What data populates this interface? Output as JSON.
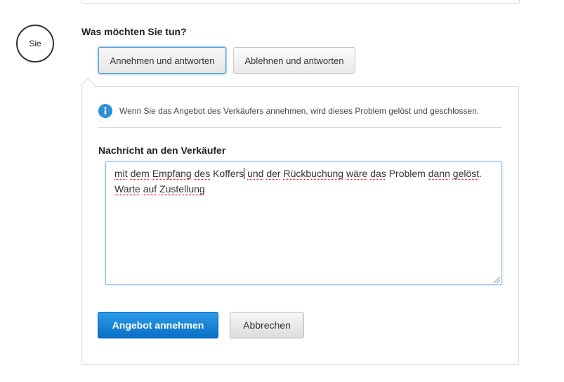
{
  "avatar": {
    "label": "Sie"
  },
  "question": "Was möchten Sie tun?",
  "options": {
    "accept_label": "Annehmen und antworten",
    "reject_label": "Ablehnen und antworten",
    "selected": "Annehmen und antworten"
  },
  "info": {
    "icon": "info-icon",
    "text": "Wenn Sie das Angebot des Verkäufers annehmen, wird dieses Problem gelöst und geschlossen."
  },
  "message": {
    "label": "Nachricht an den Verkäufer",
    "line1": {
      "w1": "mit",
      "s1": " ",
      "w2": "dem",
      "s2": " ",
      "w3": "Empfang",
      "s3": " ",
      "w4": "des",
      "s4": " ",
      "w5": "Koffers",
      "s5": " ",
      "w6": "und",
      "s6": " ",
      "w7": "der",
      "s7": " ",
      "w8": "Rückbuchung",
      "s8": " ",
      "w9": "wäre",
      "s9": " ",
      "w10": "das",
      "s10": " Problem ",
      "w11": "dann",
      "s11": " ",
      "w12": "gelöst",
      "s12": "."
    },
    "line2": {
      "w1": "Warte",
      "s1": " ",
      "w2": "auf",
      "s2": " ",
      "w3": "Zustellung"
    }
  },
  "actions": {
    "primary_label": "Angebot annehmen",
    "secondary_label": "Abbrechen"
  },
  "colors": {
    "primary": "#1a82d6",
    "info_icon": "#2e8fd8",
    "focus_border": "#7fb6e6"
  }
}
